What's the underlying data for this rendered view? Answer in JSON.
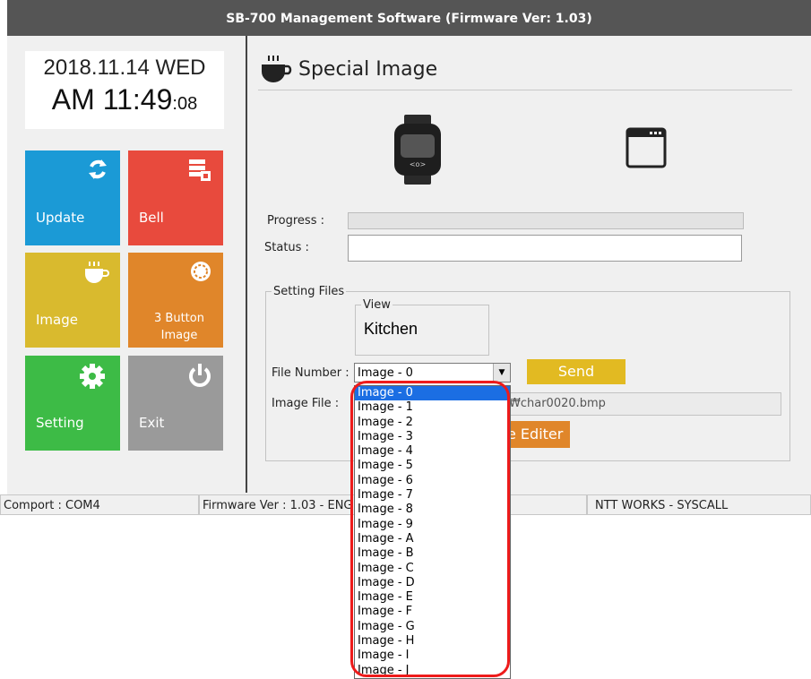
{
  "window": {
    "title": "SB-700 Management Software (Firmware Ver: 1.03)"
  },
  "clock": {
    "date": "2018.11.14 WED",
    "time_main": "AM 11:49",
    "time_sec": ":08"
  },
  "tiles": [
    {
      "label": "Update",
      "color": "#1b9ad6",
      "icon": "sync-icon"
    },
    {
      "label": "Bell",
      "color": "#e84a3d",
      "icon": "bell-schedule-icon"
    },
    {
      "label": "Image",
      "color": "#d9ba2e",
      "icon": "coffee-cup-icon"
    },
    {
      "label": "3 Button Image",
      "color": "#e0862a",
      "icon": "button-dial-icon"
    },
    {
      "label": "Setting",
      "color": "#3dbb46",
      "icon": "gear-icon"
    },
    {
      "label": "Exit",
      "color": "#9a9a9a",
      "icon": "power-icon"
    }
  ],
  "page": {
    "title": "Special Image",
    "icon": "coffee-cup-icon"
  },
  "form": {
    "progress_label": "Progress :",
    "status_label": "Status :",
    "status_value": "",
    "setting_files_label": "Setting Files",
    "view_label": "View",
    "view_value": "Kitchen",
    "file_number_label": "File Number :",
    "file_number_value": "Image - 0",
    "send_label": "Send",
    "image_file_label": "Image File :",
    "image_file_value": "₩char0020.bmp",
    "editor_label": "e Editer"
  },
  "dropdown": {
    "selected_index": 0,
    "options": [
      "Image - 0",
      "Image - 1",
      "Image - 2",
      "Image - 3",
      "Image - 4",
      "Image - 5",
      "Image - 6",
      "Image - 7",
      "Image - 8",
      "Image - 9",
      "Image - A",
      "Image - B",
      "Image - C",
      "Image - D",
      "Image - E",
      "Image - F",
      "Image - G",
      "Image - H",
      "Image - I",
      "Image - J"
    ]
  },
  "statusbar": {
    "comport": "Comport : COM4",
    "firmware": "Firmware Ver : 1.03 - ENG",
    "company": "NTT WORKS - SYSCALL"
  },
  "colors": {
    "highlight": "#ee1b1b",
    "selection": "#1b6ee3"
  }
}
